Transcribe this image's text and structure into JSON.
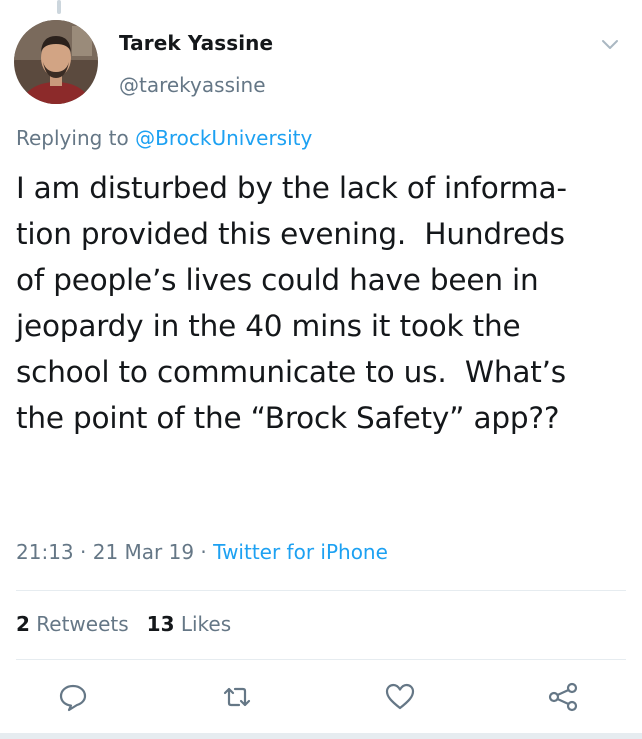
{
  "author": {
    "display_name": "Tarek Yassine",
    "handle": "@tarekyassine"
  },
  "reply": {
    "prefix": "Replying to",
    "mention": "@BrockUniversity"
  },
  "tweet": {
    "text": "I am disturbed by the lack of informa-\ntion provided this evening.  Hundreds\nof people’s lives could have been in\njeopardy in the 40 mins it took the\nschool to communicate to us.  What’s\nthe point of the “Brock Safety” app??"
  },
  "meta": {
    "time": "21:13",
    "sep1": " · ",
    "date": "21 Mar 19",
    "sep2": " · ",
    "source": "Twitter for iPhone"
  },
  "stats": {
    "retweets_count": "2",
    "retweets_label": "Retweets",
    "likes_count": "13",
    "likes_label": "Likes"
  },
  "icons": {
    "caret": "chevron-down-icon",
    "reply": "reply-icon",
    "retweet": "retweet-icon",
    "like": "heart-icon",
    "share": "share-icon"
  },
  "colors": {
    "accent": "#1da1f2",
    "secondary_text": "#657786",
    "primary_text": "#14171a",
    "divider": "#e6ecf0"
  }
}
